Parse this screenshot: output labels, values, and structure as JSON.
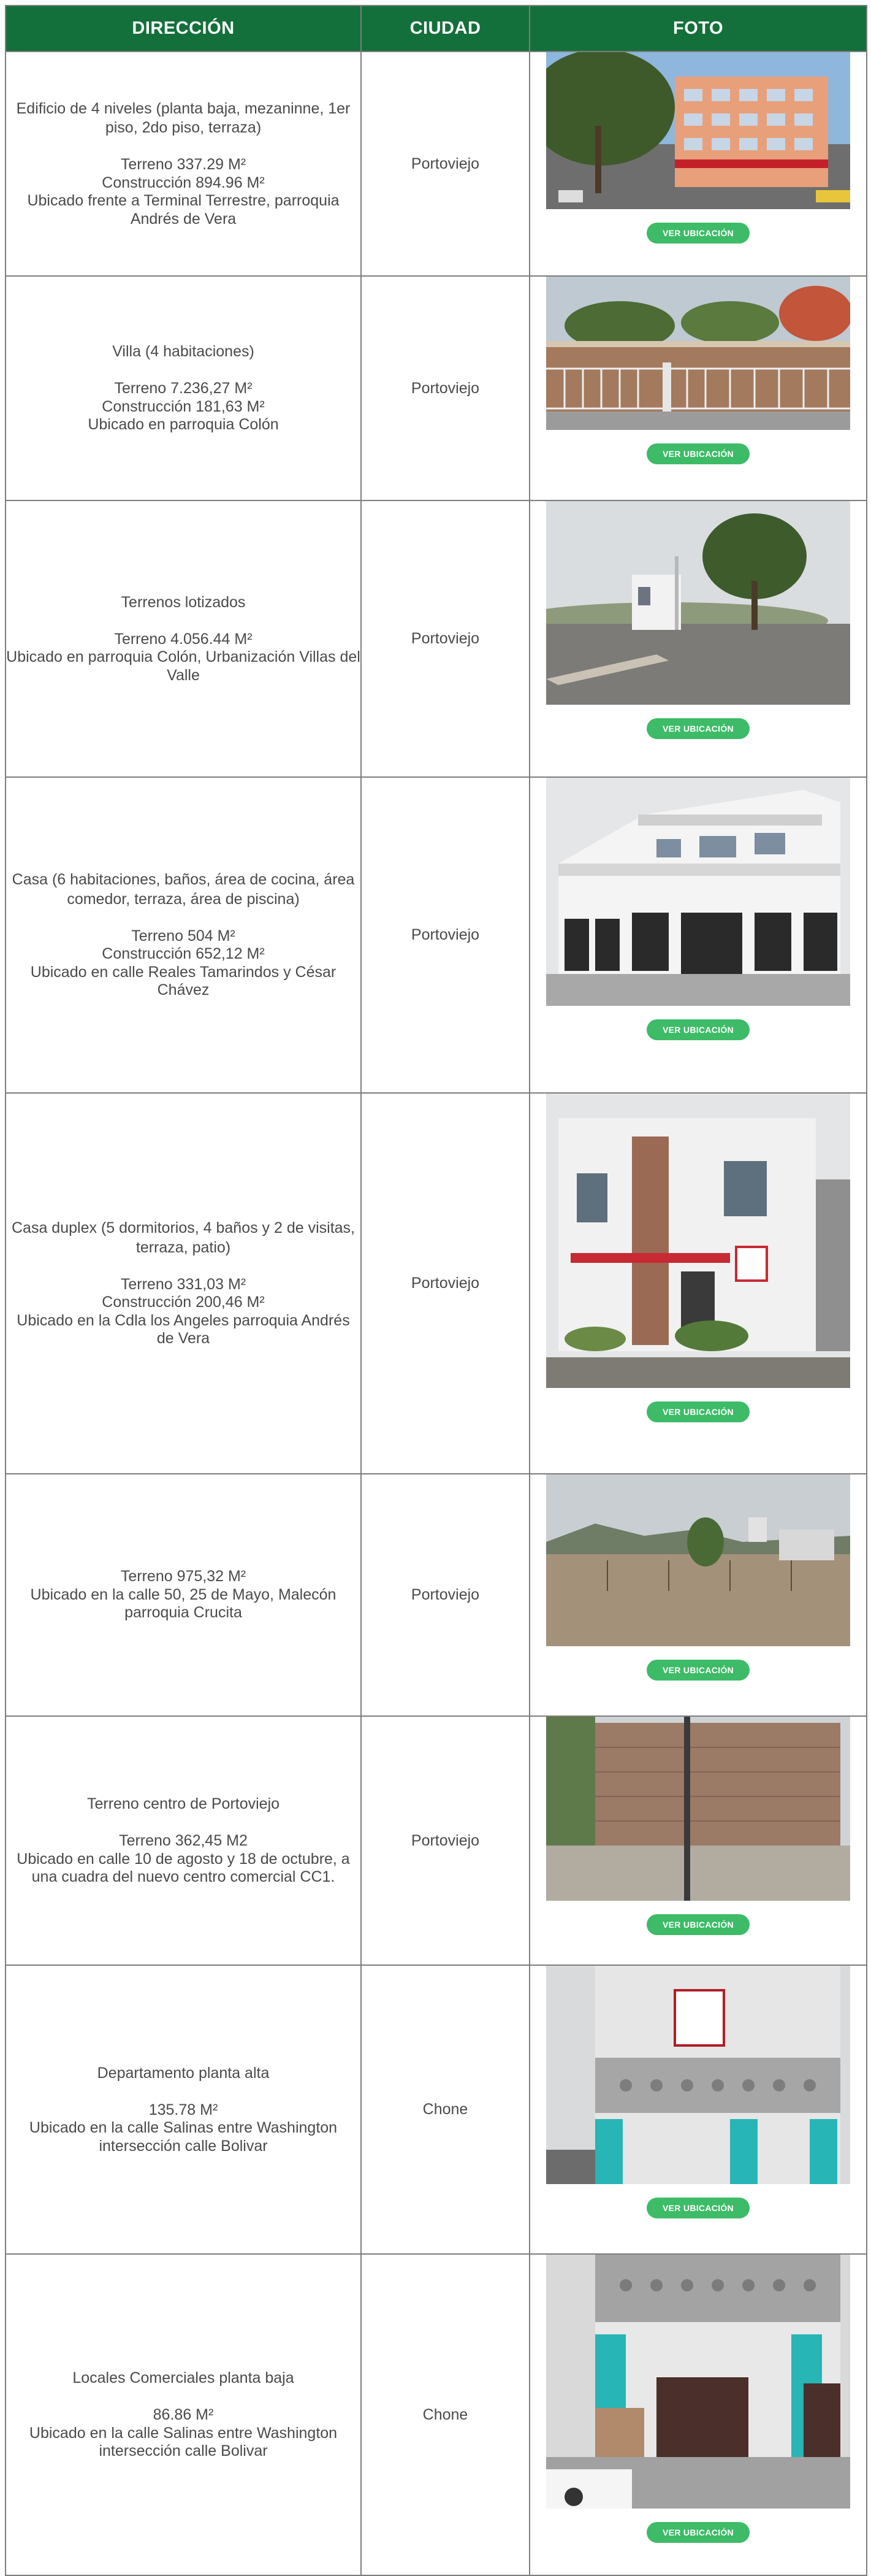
{
  "table": {
    "headers": {
      "address": "DIRECCIÓN",
      "city": "CIUDAD",
      "photo": "FOTO"
    },
    "map_button_label": "VER UBICACIÓN",
    "rows": [
      {
        "description": "Edificio de 4 niveles (planta baja, mezaninne, 1er piso, 2do piso, terraza)",
        "details": [
          "Terreno 337.29 M²",
          "Construcción 894.96 M²",
          "Ubicado frente a Terminal Terrestre, parroquia Andrés de Vera"
        ],
        "city": "Portoviejo",
        "photo": "multi-story-building-photo"
      },
      {
        "description": "Villa (4 habitaciones)",
        "details": [
          "Terreno 7.236,27 M²",
          "Construcción 181,63 M²",
          "Ubicado en parroquia Colón"
        ],
        "city": "Portoviejo",
        "photo": "villa-with-fence-photo"
      },
      {
        "description": "Terrenos lotizados",
        "details": [
          "Terreno 4.056.44 M²",
          "Ubicado en parroquia Colón, Urbanización Villas del Valle"
        ],
        "city": "Portoviejo",
        "photo": "land-plot-photo"
      },
      {
        "description": "Casa (6 habitaciones, baños, área de cocina, área comedor, terraza, área de piscina)",
        "details": [
          "Terreno 504 M²",
          "Construcción 652,12 M²",
          "Ubicado en calle Reales Tamarindos y César Chávez"
        ],
        "city": "Portoviejo",
        "photo": "white-house-photo"
      },
      {
        "description": "Casa duplex (5 dormitorios, 4 baños y 2 de visitas, terraza, patio)",
        "details": [
          "Terreno 331,03 M²",
          "Construcción 200,46 M²",
          "Ubicado en la Cdla los Angeles parroquia Andrés de Vera"
        ],
        "city": "Portoviejo",
        "photo": "duplex-house-photo"
      },
      {
        "description": "",
        "details": [
          "Terreno 975,32 M²",
          "Ubicado en la calle 50, 25 de Mayo, Malecón parroquia Crucita"
        ],
        "city": "Portoviejo",
        "photo": "vacant-lot-photo"
      },
      {
        "description": "Terreno centro de Portoviejo",
        "details": [
          "Terreno 362,45 M2",
          "Ubicado en calle 10 de agosto y 18 de octubre, a una cuadra del nuevo centro comercial CC1."
        ],
        "city": "Portoviejo",
        "photo": "walled-lot-photo"
      },
      {
        "description": "Departamento planta alta",
        "details": [
          "135.78 M²",
          "Ubicado en la calle Salinas entre Washington intersección calle Bolivar"
        ],
        "city": "Chone",
        "photo": "upper-floor-apartment-photo"
      },
      {
        "description": "Locales Comerciales planta baja",
        "details": [
          "86.86 M²",
          "Ubicado en la calle Salinas entre Washington intersección calle Bolivar"
        ],
        "city": "Chone",
        "photo": "ground-floor-shops-photo"
      }
    ]
  }
}
